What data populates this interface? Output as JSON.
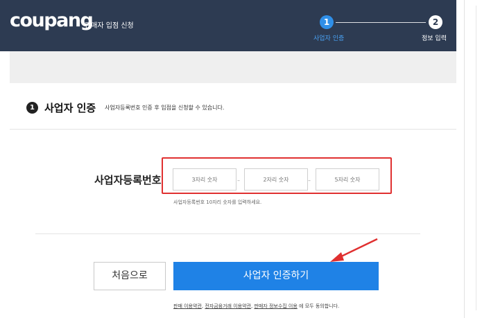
{
  "header": {
    "logo": "coupang",
    "subtitle": "판매자 입점 신청",
    "steps": [
      {
        "number": "1",
        "label": "사업자 인증",
        "active": true
      },
      {
        "number": "2",
        "label": "정보 입력",
        "active": false
      }
    ]
  },
  "section": {
    "number": "1",
    "title": "사업자 인증",
    "description": "사업자등록번호 인증 후 입점을 신청할 수 있습니다."
  },
  "business_number": {
    "label": "사업자등록번호",
    "inputs": [
      {
        "placeholder": "3자리 숫자",
        "value": ""
      },
      {
        "placeholder": "2자리 숫자",
        "value": ""
      },
      {
        "placeholder": "5자리 숫자",
        "value": ""
      }
    ],
    "separator": "–",
    "hint": "사업자등록번호 10자리 숫자를 입력하세요."
  },
  "buttons": {
    "back_label": "처음으로",
    "verify_label": "사업자 인증하기"
  },
  "terms": {
    "link1": "판매 이용약관",
    "sep1": ", ",
    "link2": "전자금융거래 이용약관",
    "sep2": ", ",
    "link3": "판매자 정보수집 이용",
    "suffix": " 에 모두 동의합니다."
  },
  "colors": {
    "header_bg": "#2d3b52",
    "accent": "#1f82e6",
    "highlight": "#e03030"
  }
}
